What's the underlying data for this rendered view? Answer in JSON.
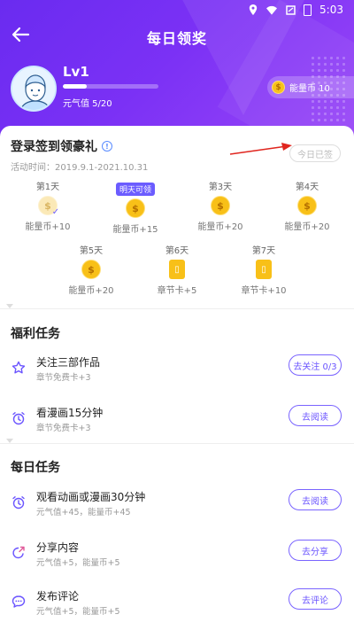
{
  "status_bar": {
    "time": "5:03"
  },
  "header": {
    "title": "每日领奖"
  },
  "profile": {
    "level": "Lv1",
    "vitality": "元气值 5/20",
    "vitality_progress": 0.25
  },
  "coin_balance": {
    "label": "能量币 10"
  },
  "signin": {
    "title": "登录签到领豪礼",
    "period": "活动时间：2019.9.1-2021.10.31",
    "button": "今日已签",
    "days": [
      {
        "label": "第1天",
        "reward": "能量币+10",
        "type": "coin",
        "signed": true
      },
      {
        "label": "明天可领",
        "reward": "能量币+15",
        "type": "coin",
        "signed": false,
        "highlight": true
      },
      {
        "label": "第3天",
        "reward": "能量币+20",
        "type": "coin",
        "signed": false
      },
      {
        "label": "第4天",
        "reward": "能量币+20",
        "type": "coin",
        "signed": false
      },
      {
        "label": "第5天",
        "reward": "能量币+20",
        "type": "coin",
        "signed": false
      },
      {
        "label": "第6天",
        "reward": "章节卡+5",
        "type": "ticket",
        "signed": false
      },
      {
        "label": "第7天",
        "reward": "章节卡+10",
        "type": "ticket",
        "signed": false
      }
    ]
  },
  "welfare": {
    "title": "福利任务",
    "tasks": [
      {
        "icon": "star-icon",
        "name": "关注三部作品",
        "sub": "章节免费卡+3",
        "button": "去关注 0/3"
      },
      {
        "icon": "alarm-clock-icon",
        "name": "看漫画15分钟",
        "sub": "章节免费卡+3",
        "button": "去阅读"
      }
    ]
  },
  "daily": {
    "title": "每日任务",
    "tasks": [
      {
        "icon": "alarm-clock-icon",
        "name": "观看动画或漫画30分钟",
        "sub": "元气值+45，能量币+45",
        "button": "去阅读"
      },
      {
        "icon": "share-icon",
        "name": "分享内容",
        "sub": "元气值+5，能量币+5",
        "button": "去分享"
      },
      {
        "icon": "comment-icon",
        "name": "发布评论",
        "sub": "元气值+5，能量币+5",
        "button": "去评论"
      }
    ]
  },
  "colors": {
    "header_start": "#6a2bf0",
    "header_end": "#9a47f7",
    "accent": "#6b55ff",
    "coin": "#f8c018"
  }
}
